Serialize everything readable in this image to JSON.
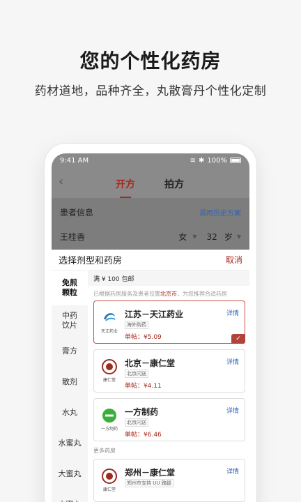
{
  "hero": {
    "title": "您的个性化药房",
    "subtitle": "药材道地，品种齐全，丸散膏丹个性化定制"
  },
  "status_bar": {
    "time": "9:41 AM",
    "battery": "100%"
  },
  "nav": {
    "tab_open": "开方",
    "tab_patient": "拍方"
  },
  "patient": {
    "section": "患者信息",
    "history_link": "调用历史方案",
    "name": "王桂香",
    "gender": "女",
    "age": "32",
    "age_unit": "岁"
  },
  "sheet": {
    "title": "选择剂型和药房",
    "cancel": "取消",
    "categories": [
      "免煎\n颗粒",
      "中药\n饮片",
      "膏方",
      "散剂",
      "水丸",
      "水蜜丸",
      "大蜜丸",
      "小蜜丸"
    ],
    "promo": "满 ¥ 100 包邮",
    "hint_prefix": "已根据药房服务及患者位置",
    "hint_city": "北京市",
    "hint_suffix": "，为您推荐合适药房",
    "detail_label": "详情",
    "more_label": "更多药房",
    "pharmacies": [
      {
        "name": "江苏－天江药业",
        "tag": "海外购药",
        "price": "单帖：¥5.09",
        "logo_caption": "天江药业",
        "selected": true,
        "logo": "tianjiang-logo"
      },
      {
        "name": "北京－康仁堂",
        "tag": "北京闪送",
        "price": "单帖：¥4.11",
        "logo_caption": "康仁堂",
        "selected": false,
        "logo": "kangrentang-logo"
      },
      {
        "name": "一方制药",
        "tag": "北京闪送",
        "price": "单帖：¥6.46",
        "logo_caption": "一方制药",
        "selected": false,
        "logo": "yifang-logo"
      }
    ],
    "more_pharmacies": [
      {
        "name": "郑州－康仁堂",
        "tag": "郑州市支持 UU 跑腿",
        "logo_caption": "康仁堂",
        "logo": "kangrentang-logo"
      }
    ]
  },
  "colors": {
    "accent": "#a8271d",
    "link": "#2f63b8"
  }
}
